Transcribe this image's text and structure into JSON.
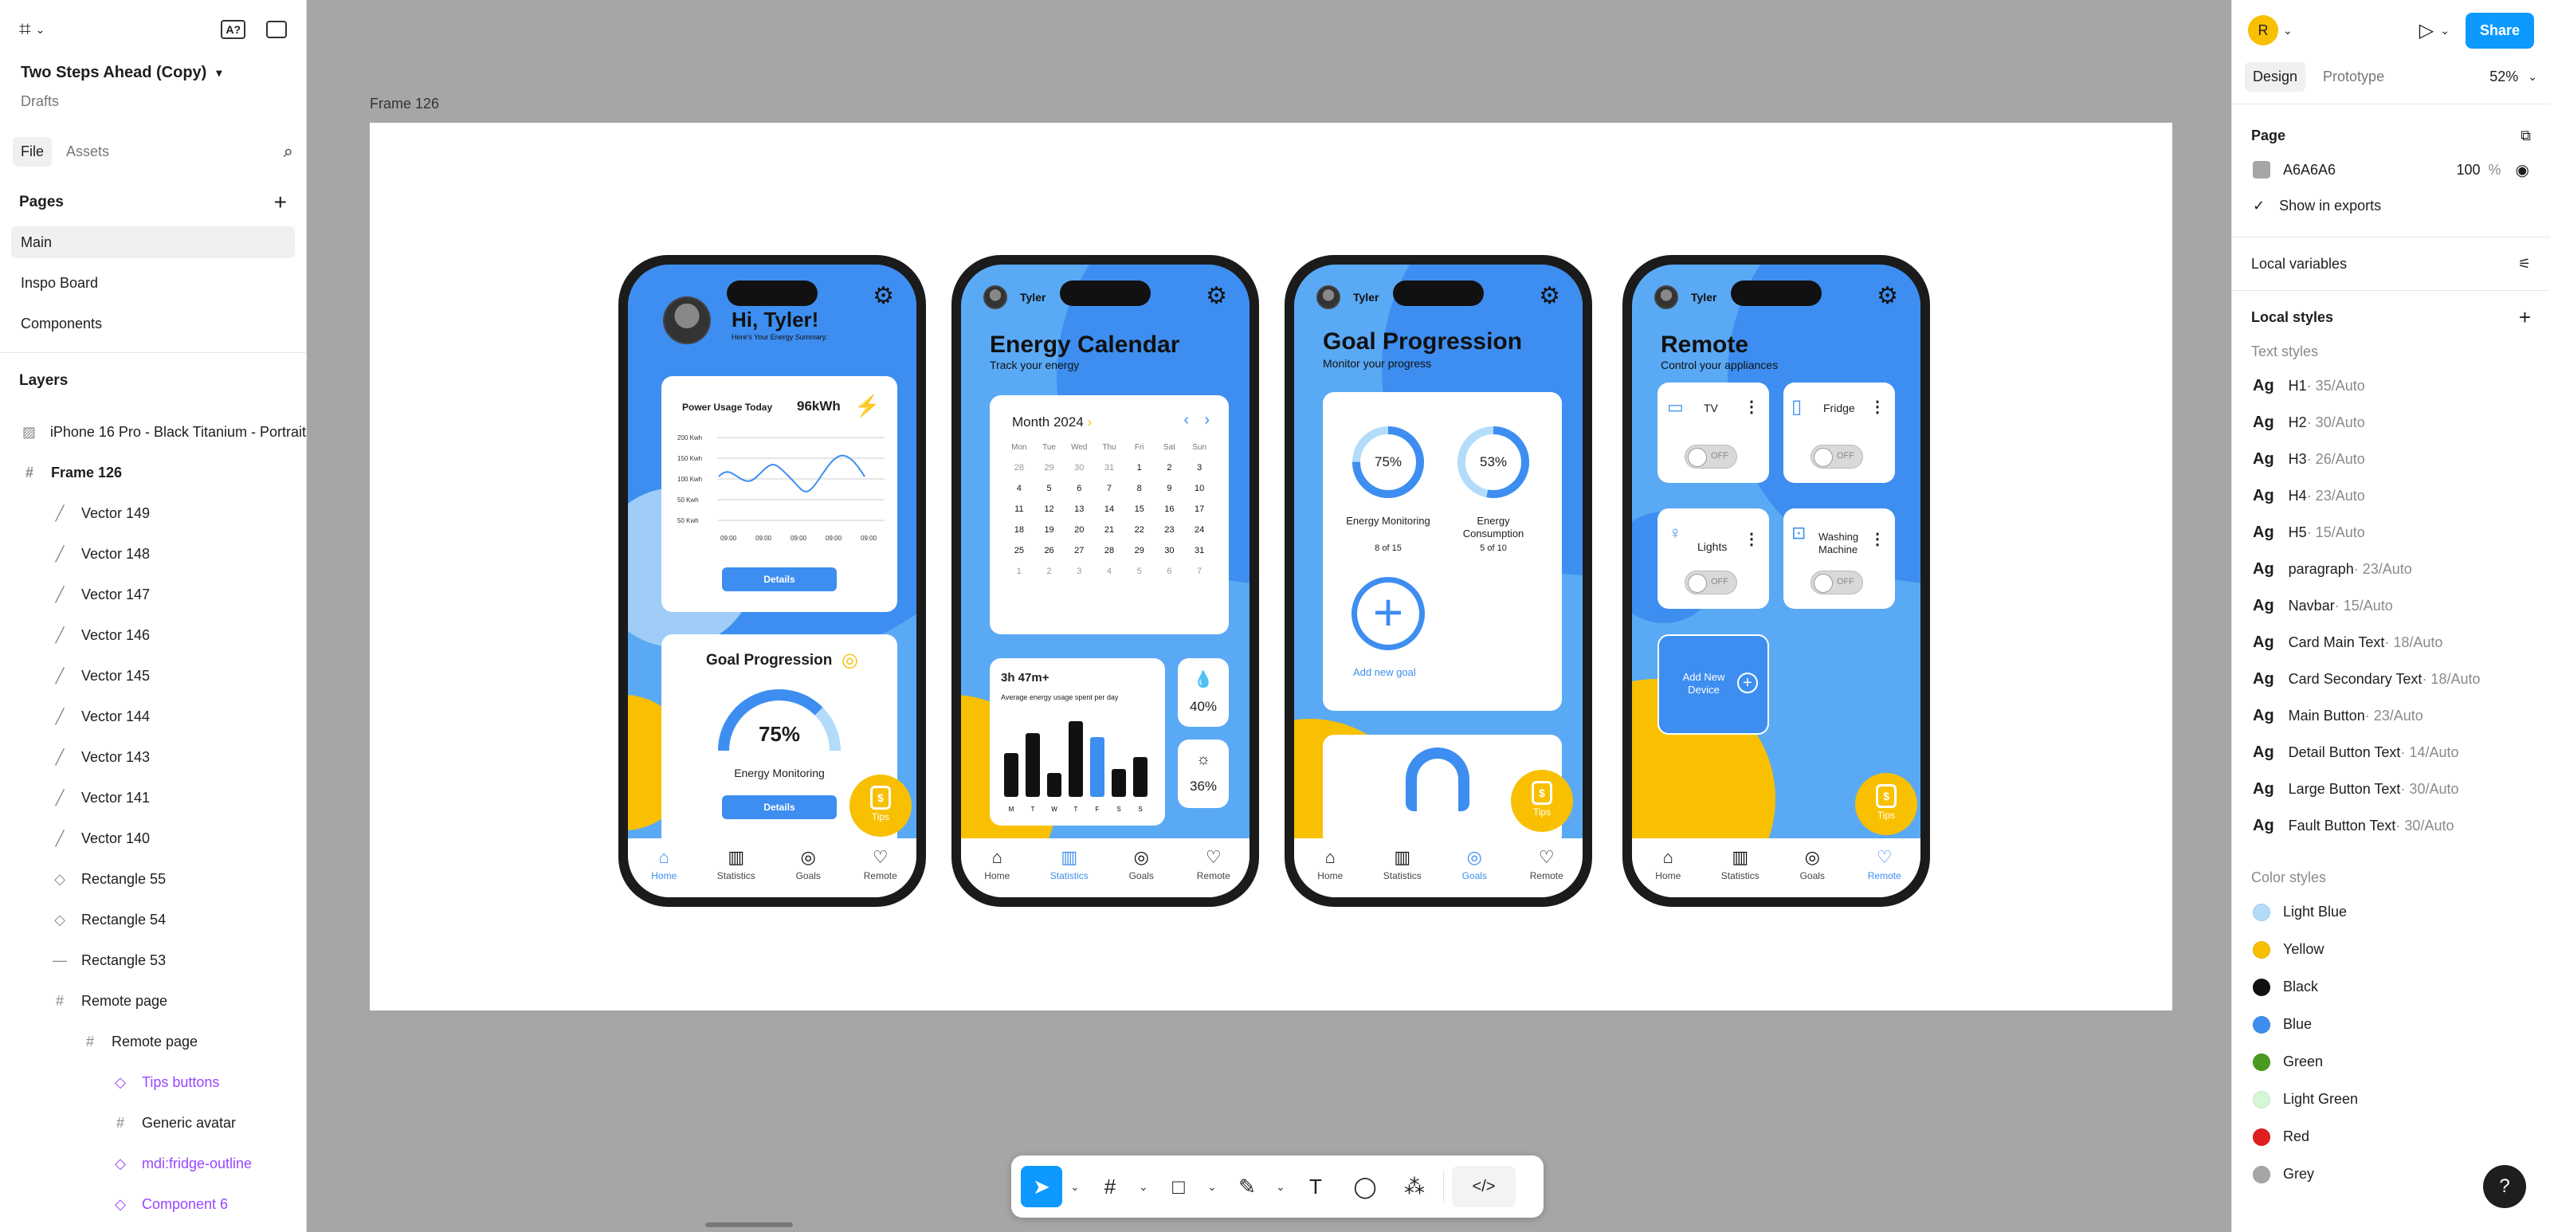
{
  "left_panel": {
    "project_name": "Two Steps Ahead (Copy)",
    "project_location": "Drafts",
    "tabs": [
      "File",
      "Assets"
    ],
    "pages_title": "Pages",
    "pages": [
      "Main",
      "Inspo Board",
      "Components"
    ],
    "layers_title": "Layers",
    "layers": [
      {
        "name": "iPhone 16 Pro - Black Titanium - Portrait",
        "icon": "image-icon"
      },
      {
        "name": "Frame 126",
        "icon": "frame-icon"
      },
      {
        "name": "Vector 149",
        "icon": "vector-icon"
      },
      {
        "name": "Vector 148",
        "icon": "vector-icon"
      },
      {
        "name": "Vector 147",
        "icon": "vector-icon"
      },
      {
        "name": "Vector 146",
        "icon": "vector-icon"
      },
      {
        "name": "Vector 145",
        "icon": "vector-icon"
      },
      {
        "name": "Vector 144",
        "icon": "vector-icon"
      },
      {
        "name": "Vector 143",
        "icon": "vector-icon"
      },
      {
        "name": "Vector 141",
        "icon": "vector-icon"
      },
      {
        "name": "Vector 140",
        "icon": "vector-icon"
      },
      {
        "name": "Rectangle 55",
        "icon": "rectangle-icon"
      },
      {
        "name": "Rectangle 54",
        "icon": "rectangle-icon"
      },
      {
        "name": "Rectangle 53",
        "icon": "line-icon"
      },
      {
        "name": "Remote page",
        "icon": "frame-icon"
      },
      {
        "name": "Remote page",
        "icon": "frame-icon"
      },
      {
        "name": "Tips buttons",
        "icon": "component-icon"
      },
      {
        "name": "Generic avatar",
        "icon": "frame-icon"
      },
      {
        "name": "mdi:fridge-outline",
        "icon": "component-icon"
      },
      {
        "name": "Component 6",
        "icon": "component-icon"
      }
    ]
  },
  "canvas": {
    "frame_label": "Frame 126",
    "nav": [
      "Home",
      "Statistics",
      "Goals",
      "Remote"
    ],
    "tips_label": "Tips",
    "home": {
      "greeting": "Hi, Tyler!",
      "subtitle": "Here's Your Energy Summary:",
      "usage_title": "Power Usage Today",
      "usage_value": "96kWh",
      "y_ticks": [
        "200 Kwh",
        "150 Kwh",
        "100 Kwh",
        "50 Kwh",
        "50 Kwh"
      ],
      "x_ticks": [
        "09:00",
        "09:00",
        "09:00",
        "09:00",
        "09:00"
      ],
      "details": "Details",
      "goal_title": "Goal Progression",
      "goal_percent": "75%",
      "goal_fraction": 0.75,
      "goal_name": "Energy Monitoring",
      "details2": "Details"
    },
    "calendar": {
      "user": "Tyler",
      "title": "Energy Calendar",
      "subtitle": "Track your energy",
      "month": "Month 2024",
      "weekdays": [
        "Mon",
        "Tue",
        "Wed",
        "Thu",
        "Fri",
        "Sat",
        "Sun"
      ],
      "days": [
        "28",
        "29",
        "30",
        "31",
        "1",
        "2",
        "3",
        "4",
        "5",
        "6",
        "7",
        "8",
        "9",
        "10",
        "11",
        "12",
        "13",
        "14",
        "15",
        "16",
        "17",
        "18",
        "19",
        "20",
        "21",
        "22",
        "23",
        "24",
        "25",
        "26",
        "27",
        "28",
        "29",
        "30",
        "31",
        "1",
        "2",
        "3",
        "4",
        "5",
        "6",
        "7"
      ],
      "usage_time": "3h 47m+",
      "usage_caption": "Average energy usage spent per day",
      "bar_days": [
        "M",
        "T",
        "W",
        "T",
        "F",
        "S",
        "S"
      ],
      "bar_values": [
        0.55,
        0.8,
        0.3,
        0.95,
        0.75,
        0.35,
        0.5
      ],
      "stat1": "40%",
      "stat2": "36%"
    },
    "goals": {
      "user": "Tyler",
      "title": "Goal Progression",
      "subtitle": "Monitor your progress",
      "ring1_value": "75%",
      "ring1_fraction": 0.75,
      "ring1_label": "Energy Monitoring",
      "ring1_sub": "8 of 15",
      "ring2_value": "53%",
      "ring2_fraction": 0.53,
      "ring2_label": "Energy Consumption",
      "ring2_sub": "5 of 10",
      "add_goal": "Add new goal"
    },
    "remote": {
      "user": "Tyler",
      "title": "Remote",
      "subtitle": "Control your appliances",
      "devices": [
        "TV",
        "Fridge",
        "Lights",
        "Washing Machine"
      ],
      "toggle_off": "OFF",
      "add_device": "Add New Device"
    }
  },
  "right_panel": {
    "user_initial": "R",
    "share": "Share",
    "tabs": [
      "Design",
      "Prototype"
    ],
    "zoom": "52%",
    "page_title": "Page",
    "page_color": "A6A6A6",
    "page_opacity": "100",
    "percent": "%",
    "show_in_exports": "Show in exports",
    "local_variables": "Local variables",
    "local_styles": "Local styles",
    "text_styles_title": "Text styles",
    "text_styles": [
      {
        "name": "H1",
        "spec": " · 35/Auto"
      },
      {
        "name": "H2",
        "spec": " · 30/Auto"
      },
      {
        "name": "H3",
        "spec": " · 26/Auto"
      },
      {
        "name": "H4",
        "spec": " · 23/Auto"
      },
      {
        "name": "H5",
        "spec": " · 15/Auto"
      },
      {
        "name": "paragraph",
        "spec": " · 23/Auto"
      },
      {
        "name": "Navbar",
        "spec": " · 15/Auto"
      },
      {
        "name": "Card Main Text",
        "spec": " · 18/Auto"
      },
      {
        "name": "Card Secondary Text",
        "spec": " · 18/Auto"
      },
      {
        "name": "Main Button",
        "spec": " · 23/Auto"
      },
      {
        "name": "Detail Button Text",
        "spec": " · 14/Auto"
      },
      {
        "name": "Large Button Text",
        "spec": " · 30/Auto"
      },
      {
        "name": "Fault Button Text",
        "spec": " · 30/Auto"
      }
    ],
    "color_styles_title": "Color styles",
    "color_styles": [
      {
        "name": "Light Blue",
        "color": "#b3dcfb"
      },
      {
        "name": "Yellow",
        "color": "#f8c000"
      },
      {
        "name": "Black",
        "color": "#111111"
      },
      {
        "name": "Blue",
        "color": "#3d8ef0"
      },
      {
        "name": "Green",
        "color": "#4a9a20"
      },
      {
        "name": "Light Green",
        "color": "#d6f7d6"
      },
      {
        "name": "Red",
        "color": "#e02020"
      },
      {
        "name": "Grey",
        "color": "#a6a6a6"
      }
    ],
    "help": "?"
  },
  "colors": {
    "accent": "#0d99ff",
    "app_blue": "#3d8ef0",
    "app_light_blue": "#9fcdf7",
    "app_yellow": "#f8c000",
    "canvas_bg": "#a6a6a6"
  }
}
